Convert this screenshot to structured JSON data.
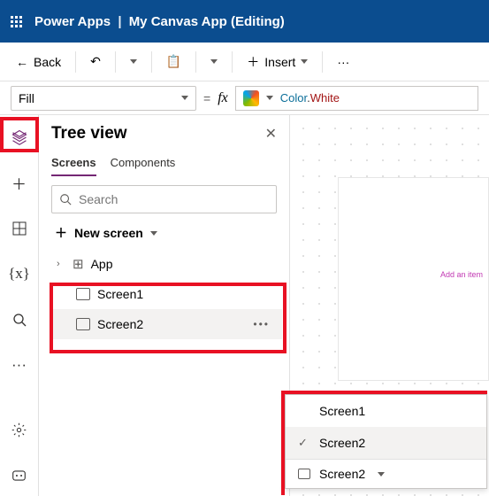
{
  "header": {
    "product": "Power Apps",
    "separator": "|",
    "app": "My Canvas App (Editing)"
  },
  "cmdbar": {
    "back": "Back",
    "insert": "Insert"
  },
  "fxbar": {
    "property": "Fill",
    "formula_ns": "Color",
    "formula_dot": ".",
    "formula_val": "White"
  },
  "panel": {
    "title": "Tree view",
    "tabs": {
      "screens": "Screens",
      "components": "Components"
    },
    "search_placeholder": "Search",
    "newscreen": "New screen",
    "tree": {
      "app": "App",
      "items": [
        {
          "label": "Screen1"
        },
        {
          "label": "Screen2"
        }
      ]
    }
  },
  "canvas": {
    "hint": "Add an item"
  },
  "popup": {
    "items": [
      {
        "label": "Screen1",
        "selected": false
      },
      {
        "label": "Screen2",
        "selected": true
      }
    ],
    "footer": "Screen2"
  }
}
